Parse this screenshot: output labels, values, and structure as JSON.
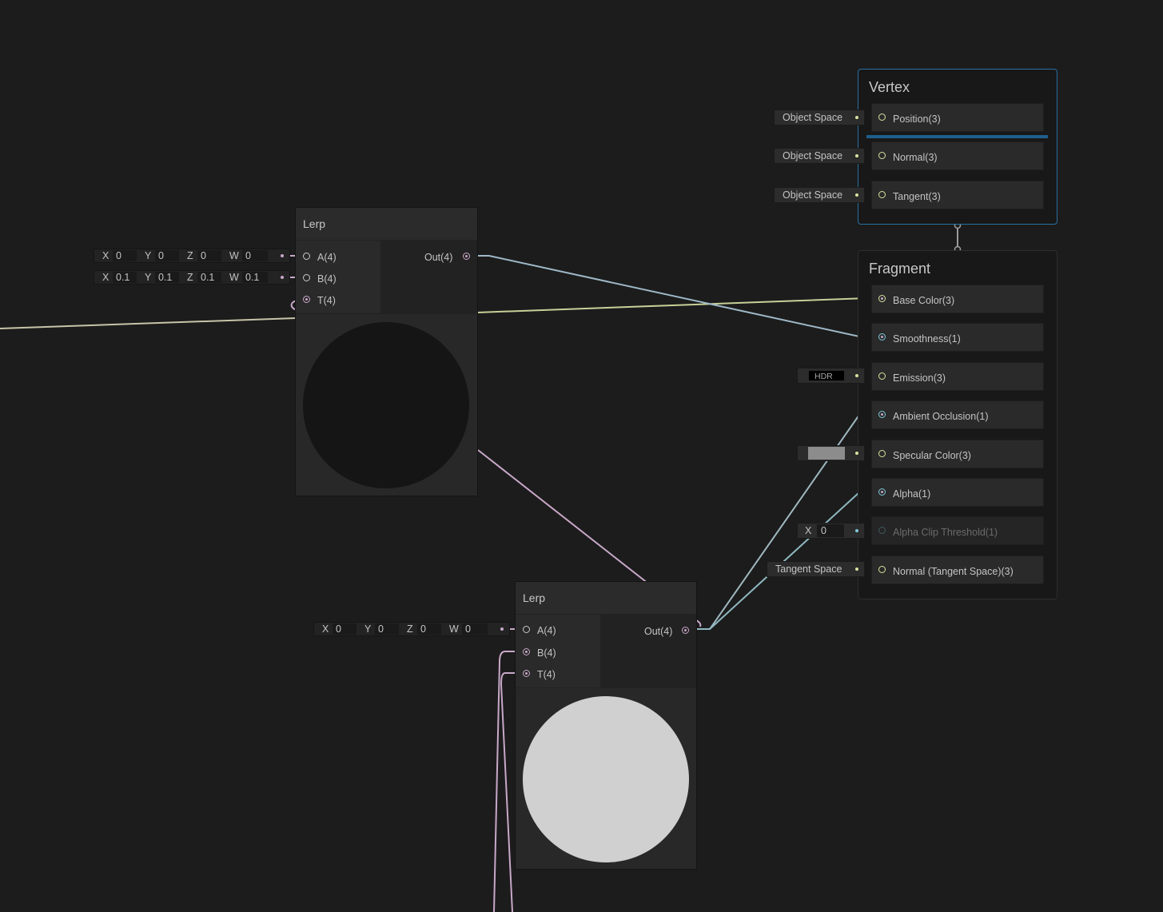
{
  "colors": {
    "background": "#1c1c1c",
    "vector4": "#c8a8c8",
    "vector3": "#d8e4a0",
    "vector1": "#7ec8d8",
    "vertex_border": "#2a6fa0",
    "vertex_separator": "#1e5f8c"
  },
  "lerp_top": {
    "title": "Lerp",
    "inputs": [
      "A(4)",
      "B(4)",
      "T(4)"
    ],
    "output": "Out(4)",
    "a_field": {
      "x": "0",
      "y": "0",
      "z": "0",
      "w": "0"
    },
    "b_field": {
      "x": "0.1",
      "y": "0.1",
      "z": "0.1",
      "w": "0.1"
    },
    "preview": "dark"
  },
  "lerp_bottom": {
    "title": "Lerp",
    "inputs": [
      "A(4)",
      "B(4)",
      "T(4)"
    ],
    "output": "Out(4)",
    "a_field": {
      "x": "0",
      "y": "0",
      "z": "0",
      "w": "0"
    },
    "preview": "light"
  },
  "field_keys": {
    "x": "X",
    "y": "Y",
    "z": "Z",
    "w": "W"
  },
  "vertex": {
    "title": "Vertex",
    "blocks": [
      {
        "label": "Position(3)",
        "field": "Object Space"
      },
      {
        "label": "Normal(3)",
        "field": "Object Space"
      },
      {
        "label": "Tangent(3)",
        "field": "Object Space"
      }
    ]
  },
  "fragment": {
    "title": "Fragment",
    "blocks": [
      {
        "label": "Base Color(3)"
      },
      {
        "label": "Smoothness(1)"
      },
      {
        "label": "Emission(3)",
        "field": "HDR"
      },
      {
        "label": "Ambient Occlusion(1)"
      },
      {
        "label": "Specular Color(3)",
        "field_color": "#8c8c8c"
      },
      {
        "label": "Alpha(1)"
      },
      {
        "label": "Alpha Clip Threshold(1)",
        "field_key": "X",
        "field": "0",
        "disabled": true
      },
      {
        "label": "Normal (Tangent Space)(3)",
        "field": "Tangent Space"
      }
    ]
  }
}
